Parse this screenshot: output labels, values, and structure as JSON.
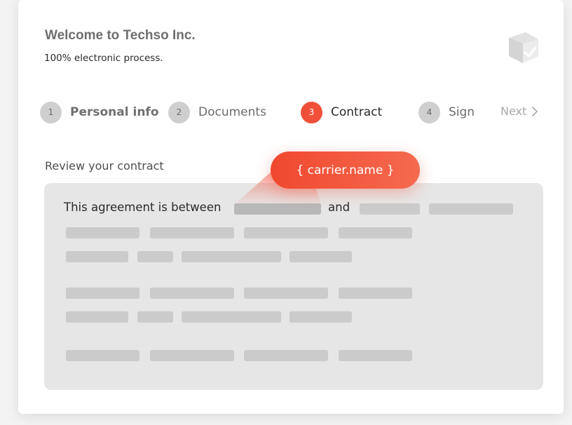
{
  "header": {
    "title": "Welcome to Techso Inc.",
    "subtitle": "100% electronic process."
  },
  "steps": [
    {
      "num": "1",
      "label": "Personal info",
      "state": "done"
    },
    {
      "num": "2",
      "label": "Documents",
      "state": "pending"
    },
    {
      "num": "3",
      "label": "Contract",
      "state": "active"
    },
    {
      "num": "4",
      "label": "Sign",
      "state": "pending"
    }
  ],
  "next_label": "Next",
  "review_label": "Review your contract",
  "contract": {
    "intro": "This agreement is between",
    "and": "and",
    "tooltip": "{ carrier.name }"
  },
  "colors": {
    "accent": "#f0503a",
    "step_inactive": "#cfcfcf",
    "document_bg": "#e6e6e6",
    "placeholder": "#cbcbcb"
  },
  "icons": {
    "logo": "box-check-icon",
    "next": "chevron-right-icon"
  }
}
